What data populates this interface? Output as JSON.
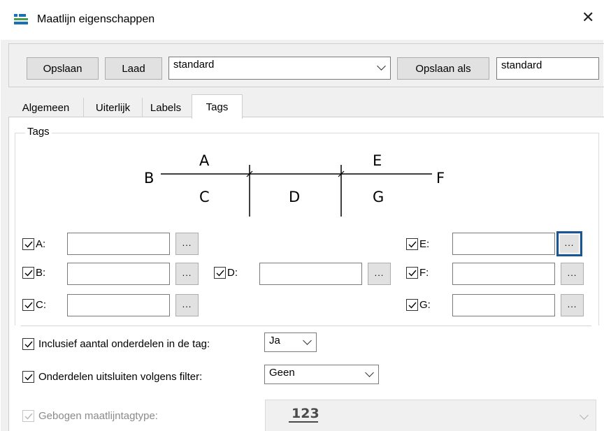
{
  "window": {
    "title": "Maatlijn eigenschappen",
    "close_glyph": "✕",
    "icon": "dimension-app-icon"
  },
  "toolbar": {
    "save_label": "Opslaan",
    "load_label": "Laad",
    "preset_value": "standard",
    "save_as_label": "Opslaan als",
    "save_as_name": "standard"
  },
  "tabs": [
    {
      "label": "Algemeen",
      "active": false
    },
    {
      "label": "Uiterlijk",
      "active": false
    },
    {
      "label": "Labels",
      "active": false
    },
    {
      "label": "Tags",
      "active": true
    }
  ],
  "tags_group": {
    "title": "Tags",
    "diagram_labels": {
      "A": "A",
      "B": "B",
      "C": "C",
      "D": "D",
      "E": "E",
      "F": "F",
      "G": "G"
    },
    "rows": {
      "A": {
        "label": "A:",
        "checked": true,
        "value": "",
        "browse": "..."
      },
      "B": {
        "label": "B:",
        "checked": true,
        "value": "",
        "browse": "..."
      },
      "C": {
        "label": "C:",
        "checked": true,
        "value": "",
        "browse": "..."
      },
      "D": {
        "label": "D:",
        "checked": true,
        "value": "",
        "browse": "..."
      },
      "E": {
        "label": "E:",
        "checked": true,
        "value": "",
        "browse": "..."
      },
      "F": {
        "label": "F:",
        "checked": true,
        "value": "",
        "browse": "..."
      },
      "G": {
        "label": "G:",
        "checked": true,
        "value": "",
        "browse": "..."
      }
    }
  },
  "options": {
    "include_count": {
      "label": "Inclusief aantal onderdelen in de tag:",
      "checked": true,
      "value": "Ja"
    },
    "exclude_filter": {
      "label": "Onderdelen uitsluiten volgens filter:",
      "checked": true,
      "value": "Geen"
    },
    "curved_type": {
      "label": "Gebogen maatlijntagtype:",
      "checked": true,
      "disabled": true,
      "value": "123"
    }
  },
  "colors": {
    "focus_border": "#1a5693",
    "button_face": "#e1e1e1",
    "dialog_bg": "#f0f0f0"
  }
}
